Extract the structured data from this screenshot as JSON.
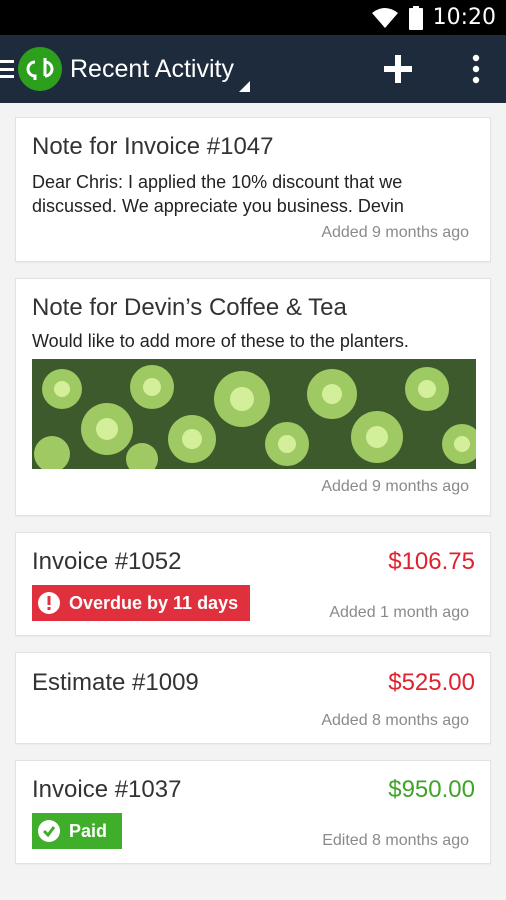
{
  "status_bar": {
    "time": "10:20"
  },
  "app_bar": {
    "title": "Recent Activity"
  },
  "colors": {
    "app_bar": "#1e2b3d",
    "brand_green": "#2ca01c",
    "amount_red": "#e0222f",
    "amount_green": "#3fa32a",
    "overdue_badge": "#e0303d",
    "paid_badge": "#3fae2a"
  },
  "icons": [
    "menu-icon",
    "quickbooks-logo",
    "add-icon",
    "more-vert-icon",
    "wifi-icon",
    "battery-icon",
    "alert-icon",
    "check-icon"
  ],
  "activity": {
    "note1": {
      "title": "Note for Invoice #1047",
      "line1": "Dear Chris:  I applied the 10% discount that we",
      "line2": "discussed.  We appreciate you business.  Devin",
      "meta": "Added 9 months ago"
    },
    "note2": {
      "title": "Note for Devin’s Coffee & Tea",
      "body": "Would like to add more of these to the planters.",
      "meta": "Added 9 months ago"
    },
    "invoice1052": {
      "title": "Invoice #1052",
      "amount": "$106.75",
      "badge": "Overdue by 11 days",
      "meta": "Added 1 month ago"
    },
    "estimate1009": {
      "title": "Estimate #1009",
      "amount": "$525.00",
      "meta": "Added 8 months ago"
    },
    "invoice1037": {
      "title": "Invoice #1037",
      "amount": "$950.00",
      "badge": "Paid",
      "meta": "Edited 8 months ago"
    }
  }
}
